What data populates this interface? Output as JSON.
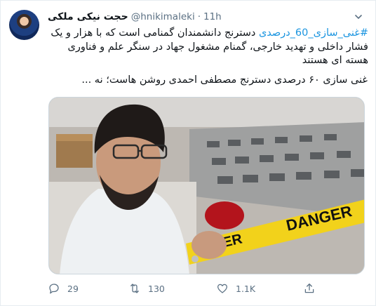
{
  "tweet": {
    "display_name": "حجت نیکی ملکی",
    "handle": "@hnikimaleki",
    "separator": "·",
    "time": "11h",
    "hashtag": "#غنی_سازی_60_درصدی",
    "body_line1_rest": " دسترنج دانشمندان گمنامی است که با هزار و یک فشار داخلی و تهدید خارجی، گمنام مشغول جهاد در سنگر علم و فناوری هسته ای هستند",
    "body_para2": "غنی سازی ۶۰ درصدی دسترنج مصطفی احمدی روشن هاست؛ نه ...",
    "image_sign_text": "DANGER",
    "image_tape_text": "NGER"
  },
  "actions": {
    "reply": {
      "icon": "reply-icon",
      "count": "29"
    },
    "retweet": {
      "icon": "retweet-icon",
      "count": "130"
    },
    "like": {
      "icon": "heart-icon",
      "count": "1.1K"
    },
    "share": {
      "icon": "share-icon",
      "count": ""
    }
  },
  "colors": {
    "link": "#1b95e0",
    "muted": "#5b7083",
    "border": "#e6ecf0"
  }
}
